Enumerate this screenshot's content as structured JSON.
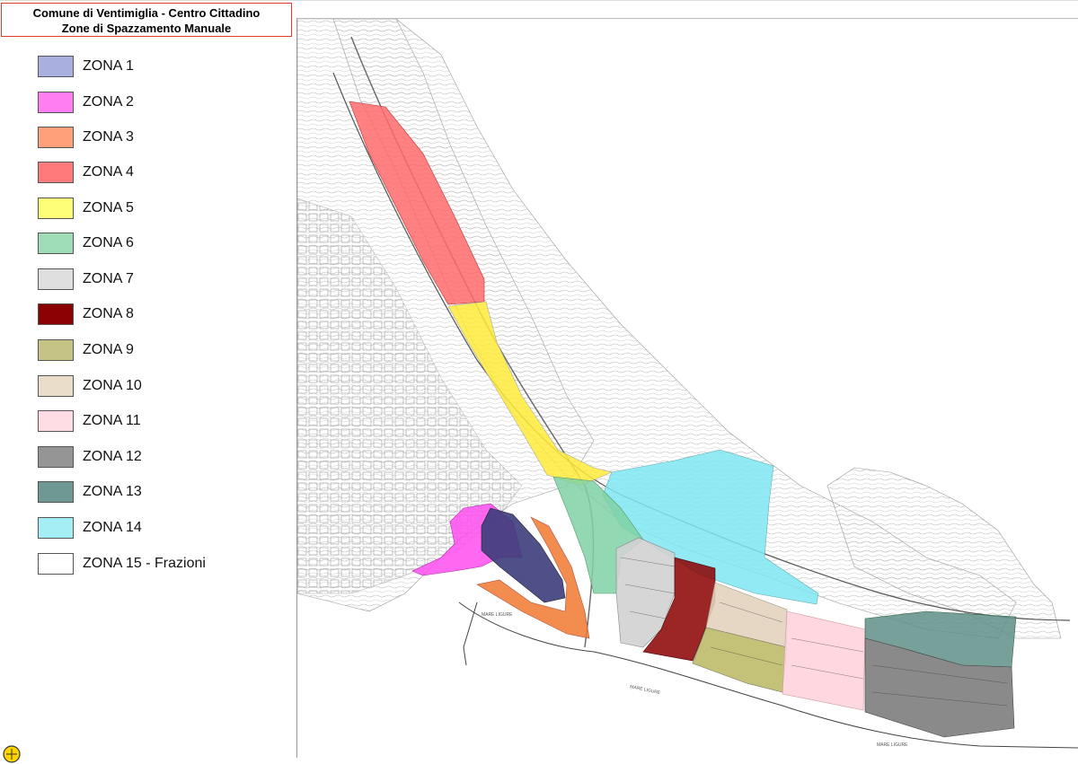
{
  "title": {
    "line1": "Comune di Ventimiglia - Centro Cittadino",
    "line2": "Zone di Spazzamento Manuale"
  },
  "legend": [
    {
      "label": "ZONA 1",
      "color": "#a9b0df"
    },
    {
      "label": "ZONA 2",
      "color": "#ff7ef2"
    },
    {
      "label": "ZONA 3",
      "color": "#ffa07a"
    },
    {
      "label": "ZONA 4",
      "color": "#ff7b7b"
    },
    {
      "label": "ZONA 5",
      "color": "#ffff77"
    },
    {
      "label": "ZONA 6",
      "color": "#9fdcb8"
    },
    {
      "label": "ZONA 7",
      "color": "#dedede"
    },
    {
      "label": "ZONA 8",
      "color": "#8b0000"
    },
    {
      "label": "ZONA 9",
      "color": "#c6c484"
    },
    {
      "label": "ZONA 10",
      "color": "#e9dcc8"
    },
    {
      "label": "ZONA 11",
      "color": "#ffdce4"
    },
    {
      "label": "ZONA 12",
      "color": "#959595"
    },
    {
      "label": "ZONA 13",
      "color": "#6f9894"
    },
    {
      "label": "ZONA 14",
      "color": "#a6eef5"
    },
    {
      "label": "ZONA 15 - Frazioni",
      "color": "#ffffff"
    }
  ],
  "map": {
    "sea_labels": [
      "MARE LIGURE",
      "MARE LIGURE",
      "MARE LIGURE"
    ]
  }
}
